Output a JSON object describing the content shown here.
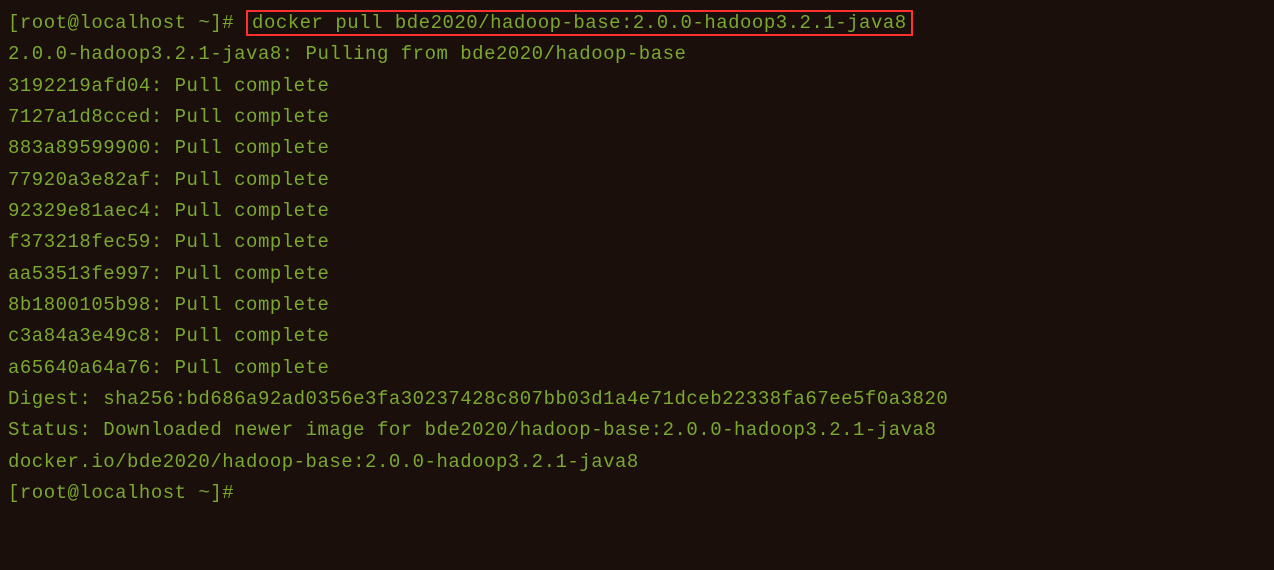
{
  "prompt1": {
    "user_host": "[root@localhost ~]#",
    "command": "docker pull bde2020/hadoop-base:2.0.0-hadoop3.2.1-java8"
  },
  "output": {
    "pulling_line": "2.0.0-hadoop3.2.1-java8: Pulling from bde2020/hadoop-base",
    "layers": [
      "3192219afd04: Pull complete",
      "7127a1d8cced: Pull complete",
      "883a89599900: Pull complete",
      "77920a3e82af: Pull complete",
      "92329e81aec4: Pull complete",
      "f373218fec59: Pull complete",
      "aa53513fe997: Pull complete",
      "8b1800105b98: Pull complete",
      "c3a84a3e49c8: Pull complete",
      "a65640a64a76: Pull complete"
    ],
    "digest": "Digest: sha256:bd686a92ad0356e3fa30237428c807bb03d1a4e71dceb22338fa67ee5f0a3820",
    "status": "Status: Downloaded newer image for bde2020/hadoop-base:2.0.0-hadoop3.2.1-java8",
    "ref": "docker.io/bde2020/hadoop-base:2.0.0-hadoop3.2.1-java8"
  },
  "prompt2": {
    "user_host": "[root@localhost ~]#"
  }
}
